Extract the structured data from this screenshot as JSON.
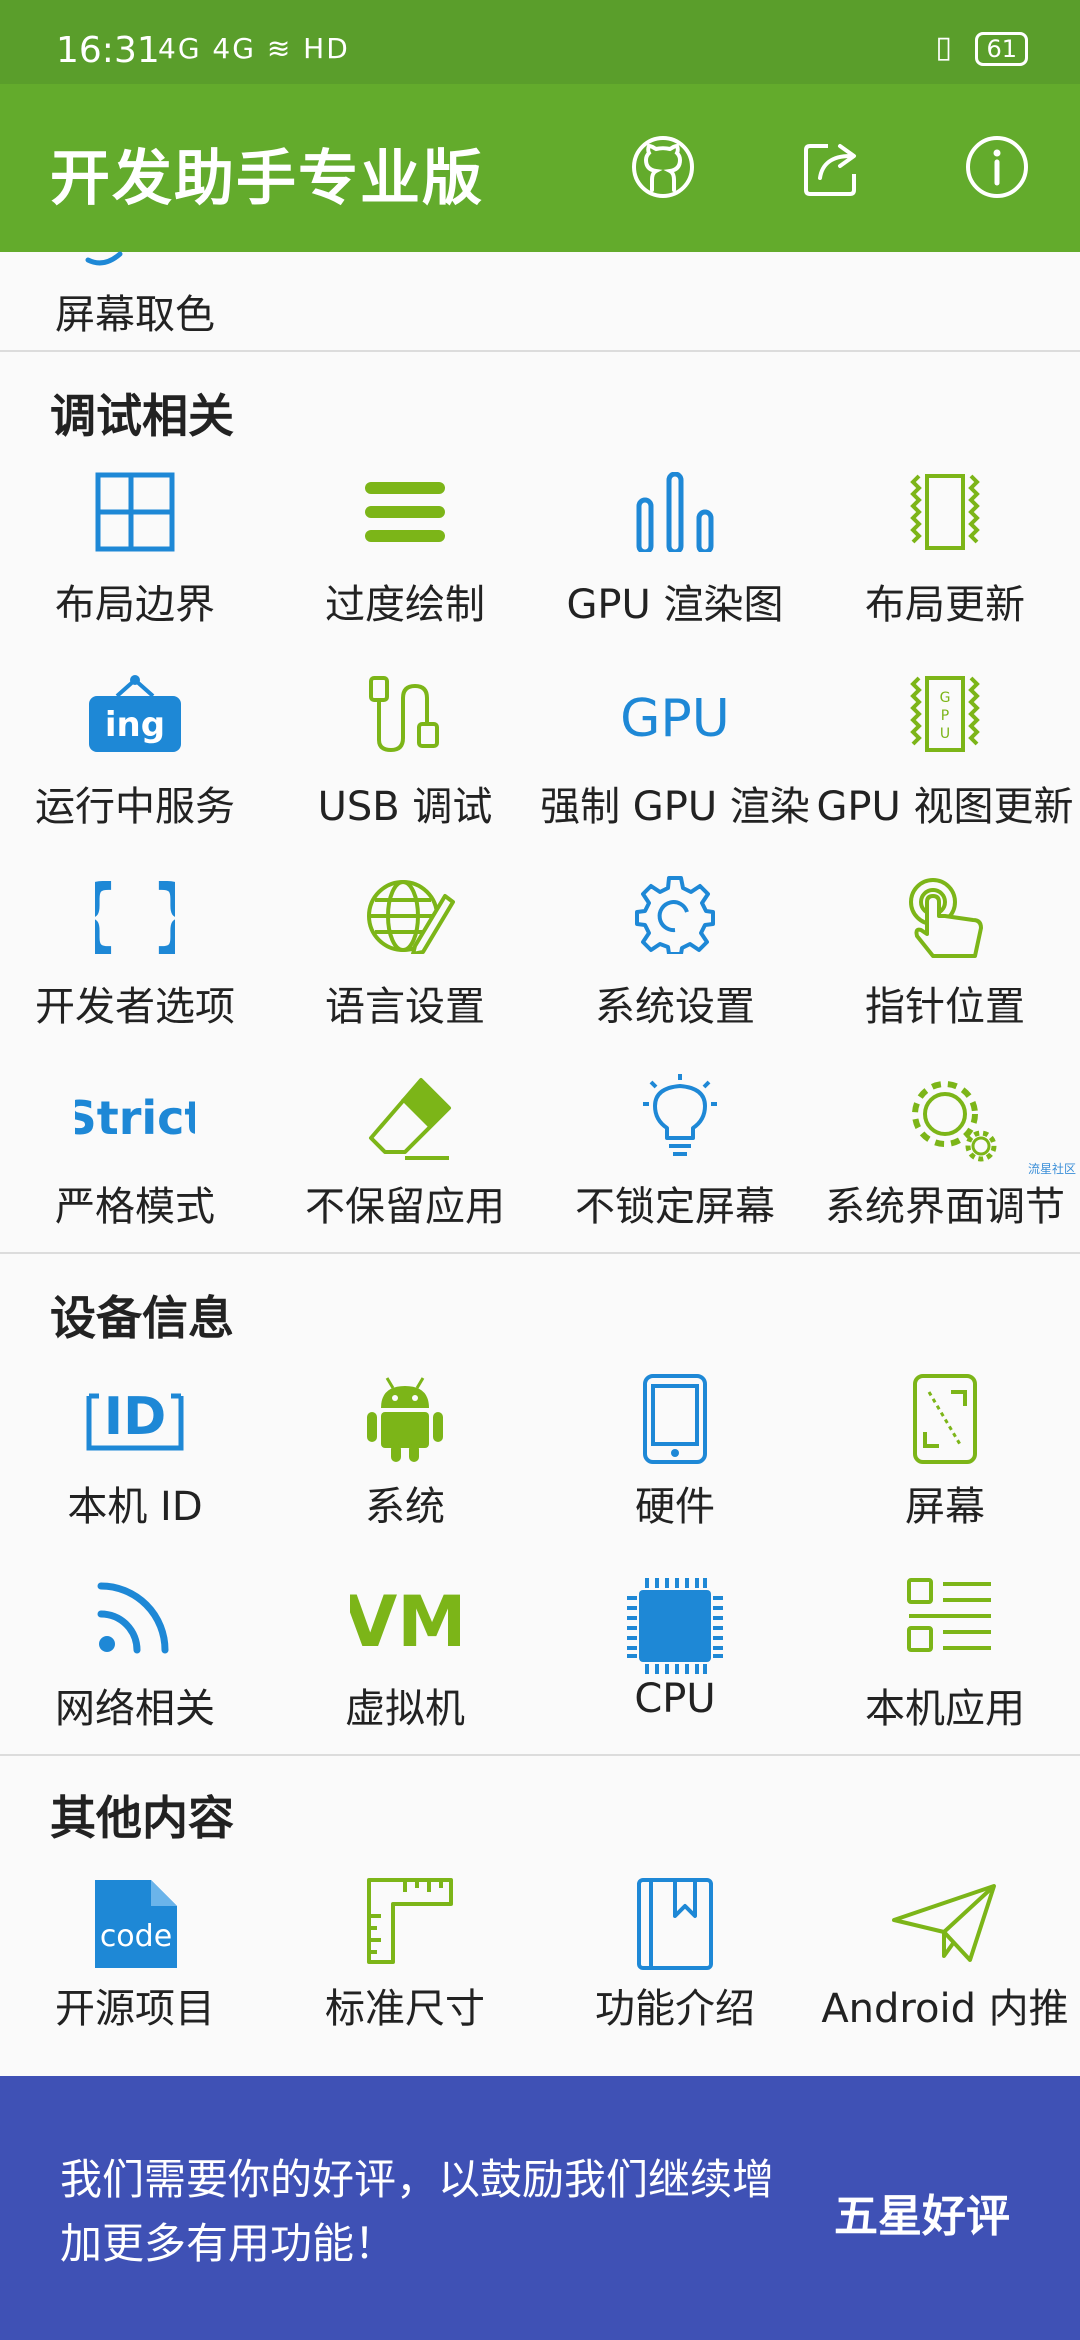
{
  "status_bar": {
    "time": "16:31",
    "signal": "4G 4G ≋ HD",
    "battery": "61"
  },
  "app_bar": {
    "title": "开发助手专业版",
    "icons": [
      "github-icon",
      "share-icon",
      "info-icon"
    ]
  },
  "partial_item": {
    "label": "屏幕取色"
  },
  "sections": {
    "debug": {
      "title": "调试相关",
      "items": [
        {
          "label": "布局边界",
          "icon": "layout-bounds-icon"
        },
        {
          "label": "过度绘制",
          "icon": "overdraw-icon"
        },
        {
          "label": "GPU 渲染图",
          "icon": "gpu-render-chart-icon"
        },
        {
          "label": "布局更新",
          "icon": "layout-update-icon"
        },
        {
          "label": "运行中服务",
          "icon": "running-services-icon",
          "badge": "ing"
        },
        {
          "label": "USB 调试",
          "icon": "usb-debug-icon"
        },
        {
          "label": "强制 GPU 渲染",
          "icon": "gpu-text-icon",
          "badge": "GPU"
        },
        {
          "label": "GPU 视图更新",
          "icon": "gpu-view-update-icon",
          "badge": "GPU"
        },
        {
          "label": "开发者选项",
          "icon": "braces-icon"
        },
        {
          "label": "语言设置",
          "icon": "language-globe-icon"
        },
        {
          "label": "系统设置",
          "icon": "gear-icon"
        },
        {
          "label": "指针位置",
          "icon": "pointer-touch-icon"
        },
        {
          "label": "严格模式",
          "icon": "strict-text-icon",
          "badge": "Strict"
        },
        {
          "label": "不保留应用",
          "icon": "eraser-icon"
        },
        {
          "label": "不锁定屏幕",
          "icon": "lightbulb-icon"
        },
        {
          "label": "系统界面调节",
          "icon": "gears-icon"
        }
      ]
    },
    "device": {
      "title": "设备信息",
      "items": [
        {
          "label": "本机 ID",
          "icon": "id-icon",
          "badge": "ID"
        },
        {
          "label": "系统",
          "icon": "android-icon"
        },
        {
          "label": "硬件",
          "icon": "phone-hardware-icon"
        },
        {
          "label": "屏幕",
          "icon": "screen-icon"
        },
        {
          "label": "网络相关",
          "icon": "wifi-icon"
        },
        {
          "label": "虚拟机",
          "icon": "vm-text-icon",
          "badge": "VM"
        },
        {
          "label": "CPU",
          "icon": "cpu-chip-icon"
        },
        {
          "label": "本机应用",
          "icon": "app-list-icon"
        }
      ]
    },
    "other": {
      "title": "其他内容",
      "items": [
        {
          "label": "开源项目",
          "icon": "code-file-icon",
          "badge": "code"
        },
        {
          "label": "标准尺寸",
          "icon": "ruler-icon"
        },
        {
          "label": "功能介绍",
          "icon": "book-icon"
        },
        {
          "label": "Android 内推",
          "icon": "paper-plane-icon"
        }
      ]
    }
  },
  "watermark": "流星社区",
  "banner": {
    "message": "我们需要你的好评，以鼓励我们继续增加更多有用功能！",
    "button": "五星好评"
  },
  "colors": {
    "status_bar": "#5a9e2b",
    "app_bar": "#63ab2c",
    "icon_blue": "#1e88d6",
    "icon_green": "#7cb518",
    "banner": "#3f51b5"
  }
}
